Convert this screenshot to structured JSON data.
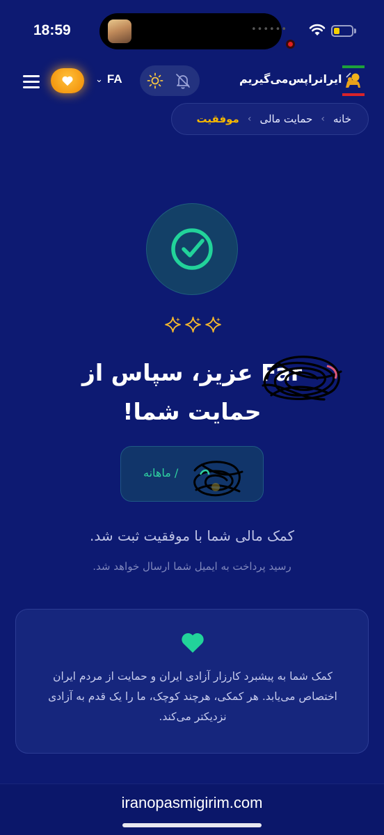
{
  "status_bar": {
    "time": "18:59",
    "island_dots": "••••••",
    "battery_level_percent": 30,
    "battery_color": "#f5d000"
  },
  "header": {
    "brand": "ایرانراپس‌می‌گیریم",
    "language": "FA",
    "menu_icon": "hamburger-icon",
    "heart_icon": "heart-icon",
    "theme_icon": "sun-icon",
    "notification_icon": "bell-off-icon",
    "accent_color": "#f59a12"
  },
  "breadcrumb": {
    "items": [
      "خانه",
      "حمایت مالی"
    ],
    "current": "موفقیت",
    "current_color": "#f6b800"
  },
  "success": {
    "icon": "check-circle-icon",
    "sparkles_icon": "sparkles-icon",
    "check_color": "#22d39a"
  },
  "title": {
    "line1": "Far عزیز، سپاس از",
    "line2": "حمایت شما!"
  },
  "amount": {
    "period": "/ ماهانه"
  },
  "messages": {
    "primary": "کمک مالی شما با موفقیت ثبت شد.",
    "secondary": "رسید پرداخت به ایمیل شما ارسال خواهد شد."
  },
  "info_card": {
    "icon": "heart-icon",
    "text": "کمک شما به پیشبرد کارزار آزادی ایران و حمایت از مردم ایران اختصاص می‌یابد. هر کمکی، هرچند کوچک، ما را یک قدم به آزادی نزدیکتر می‌کند."
  },
  "browser": {
    "url": "iranopasmigirim.com"
  }
}
